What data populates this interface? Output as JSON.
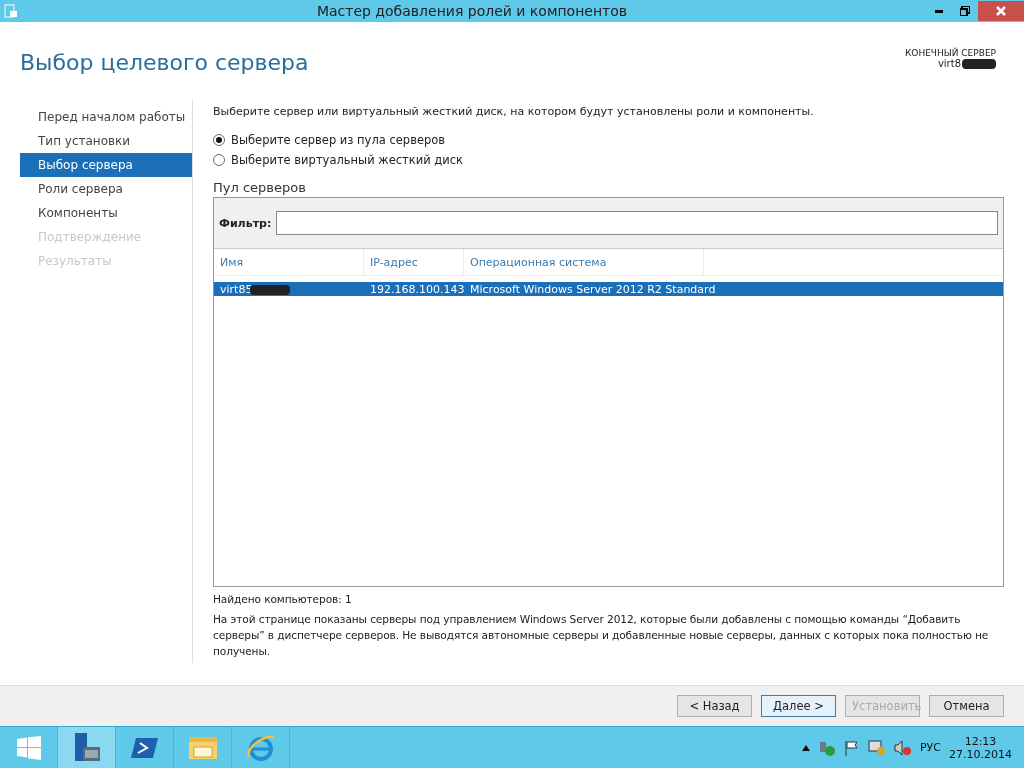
{
  "window": {
    "title": "Мастер добавления ролей и компонентов"
  },
  "page_title": "Выбор целевого сервера",
  "destination": {
    "label": "КОНЕЧНЫЙ СЕРВЕР",
    "server": "virt8"
  },
  "steps": [
    {
      "label": "Перед началом работы",
      "selected": false,
      "disabled": false
    },
    {
      "label": "Тип установки",
      "selected": false,
      "disabled": false
    },
    {
      "label": "Выбор сервера",
      "selected": true,
      "disabled": false
    },
    {
      "label": "Роли сервера",
      "selected": false,
      "disabled": false
    },
    {
      "label": "Компоненты",
      "selected": false,
      "disabled": false
    },
    {
      "label": "Подтверждение",
      "selected": false,
      "disabled": true
    },
    {
      "label": "Результаты",
      "selected": false,
      "disabled": true
    }
  ],
  "intro": "Выберите сервер или виртуальный жесткий диск, на котором будут установлены роли и компоненты.",
  "options": [
    {
      "label": "Выберите сервер из пула серверов",
      "selected": true
    },
    {
      "label": "Выберите виртуальный жесткий диск",
      "selected": false
    }
  ],
  "pool": {
    "title": "Пул серверов",
    "filter_label": "Фильтр:",
    "columns": [
      "Имя",
      "IP-адрес",
      "Операционная система"
    ],
    "rows": [
      {
        "cells": [
          "virt85",
          "192.168.100.143",
          "Microsoft Windows Server 2012 R2 Standard"
        ],
        "selected": true
      }
    ]
  },
  "found": "Найдено компьютеров: 1",
  "note": "На этой странице показаны серверы под управлением Windows Server 2012, которые были добавлены с помощью команды “Добавить серверы” в диспетчере серверов. Не выводятся автономные серверы и добавленные новые серверы, данных с которых пока полностью не получены.",
  "buttons": [
    {
      "label": "< Назад",
      "disabled": false,
      "selected": false
    },
    {
      "label": "Далее >",
      "disabled": false,
      "selected": true
    },
    {
      "label": "Установить",
      "disabled": true,
      "selected": false
    },
    {
      "label": "Отмена",
      "disabled": false,
      "selected": false
    }
  ],
  "taskbar": {
    "apps": [
      {
        "kind": "start",
        "selected": false
      },
      {
        "kind": "servermanager",
        "selected": true
      },
      {
        "kind": "powershell",
        "selected": false
      },
      {
        "kind": "explorer",
        "selected": false
      },
      {
        "kind": "ie",
        "selected": false
      }
    ],
    "language": "РУС",
    "time": "12:13",
    "date": "27.10.2014"
  }
}
